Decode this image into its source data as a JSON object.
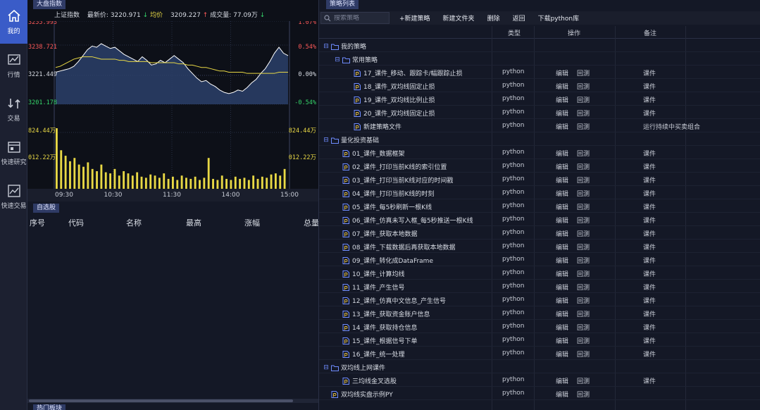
{
  "nav": [
    {
      "label": "我的",
      "icon": "home-icon",
      "active": true
    },
    {
      "label": "行情",
      "icon": "line-chart-icon"
    },
    {
      "label": "交易",
      "icon": "exchange-icon"
    },
    {
      "label": "快速研究",
      "icon": "research-icon"
    },
    {
      "label": "快速交易",
      "icon": "trade-chart-icon"
    }
  ],
  "market": {
    "tab": "大盘指数",
    "name": "上证指数",
    "latest_label": "最新价:",
    "latest": "3220.971",
    "avg_label": "均价",
    "avg": "3209.227",
    "vol_label": "成交量:",
    "vol": "77.09万"
  },
  "chart_data": {
    "type": "line",
    "x_ticks": [
      "09:30",
      "10:30",
      "11:30",
      "14:00",
      "15:00"
    ],
    "y_left_ticks": [
      "3255.993",
      "3238.721",
      "3221.449",
      "3201.178",
      "824.44万",
      "012.22万"
    ],
    "y_right_ticks": [
      "1.07%",
      "0.54%",
      "0.00%",
      "-0.54%",
      "824.44万",
      "012.22万"
    ],
    "ylim": [
      3186.0,
      3256.0
    ],
    "price": [
      3213,
      3214,
      3215,
      3216,
      3218,
      3222,
      3227,
      3232,
      3235,
      3234,
      3237,
      3235,
      3233,
      3234,
      3231,
      3228,
      3226,
      3224,
      3222,
      3226,
      3223,
      3219,
      3220,
      3223,
      3221,
      3224,
      3227,
      3224,
      3221,
      3216,
      3212,
      3208,
      3205,
      3206,
      3203,
      3201,
      3198,
      3196,
      3195,
      3196,
      3198,
      3197,
      3200,
      3204,
      3207,
      3212,
      3216,
      3222,
      3229,
      3234,
      3229,
      3227
    ],
    "avg": [
      3217,
      3218,
      3220,
      3222,
      3224,
      3225,
      3226,
      3226,
      3226,
      3225,
      3224,
      3224,
      3224,
      3224,
      3223,
      3223,
      3222,
      3222,
      3222,
      3222,
      3222,
      3221,
      3221,
      3221,
      3221,
      3221,
      3221,
      3220,
      3220,
      3219,
      3219,
      3218,
      3217,
      3217,
      3216,
      3215,
      3214,
      3214,
      3213,
      3213,
      3213,
      3213,
      3212,
      3212,
      3212,
      3212,
      3212,
      3212,
      3212,
      3213,
      3213,
      3213
    ],
    "volume": [
      55,
      35,
      30,
      25,
      28,
      22,
      20,
      24,
      18,
      16,
      22,
      15,
      14,
      18,
      12,
      16,
      14,
      12,
      15,
      11,
      10,
      13,
      12,
      10,
      14,
      9,
      11,
      8,
      12,
      10,
      9,
      11,
      8,
      10,
      28,
      9,
      8,
      12,
      9,
      8,
      11,
      9,
      10,
      8,
      12,
      9,
      11,
      10,
      13,
      14,
      12,
      18
    ],
    "colors": {
      "price": "#ffffff",
      "avg": "#e8d845",
      "volume": "#e8d845",
      "area": "#2b3f6a"
    }
  },
  "watch": {
    "tab": "自选股",
    "columns": [
      "序号",
      "代码",
      "名称",
      "最高",
      "涨幅",
      "总量"
    ]
  },
  "bottom_tab": "热门板块",
  "strategy": {
    "tab": "策略列表",
    "search_placeholder": "搜索策略",
    "toolbar": [
      "+新建策略",
      "新建文件夹",
      "删除",
      "返回",
      "下载python库"
    ],
    "columns": [
      "类型",
      "操作",
      "备注"
    ],
    "rows": [
      {
        "level": 0,
        "kind": "folder",
        "name": "我的策略",
        "toggle": "⊟"
      },
      {
        "level": 1,
        "kind": "folder",
        "name": "常用策略",
        "toggle": "⊟"
      },
      {
        "level": 2,
        "kind": "file",
        "name": "17_课件_移动、跟踪卡/幅跟踪止损",
        "type": "python",
        "ops": [
          "编辑",
          "回测"
        ],
        "note": "课件"
      },
      {
        "level": 2,
        "kind": "file",
        "name": "18_课件_双均线固定止损",
        "type": "python",
        "ops": [
          "编辑",
          "回测"
        ],
        "note": "课件"
      },
      {
        "level": 2,
        "kind": "file",
        "name": "19_课件_双均线比例止损",
        "type": "python",
        "ops": [
          "编辑",
          "回测"
        ],
        "note": "课件"
      },
      {
        "level": 2,
        "kind": "file",
        "name": "20_课件_双均线固定止损",
        "type": "python",
        "ops": [
          "编辑",
          "回测"
        ],
        "note": "课件"
      },
      {
        "level": 2,
        "kind": "file",
        "name": "新建策略文件",
        "type": "python",
        "ops": [
          "编辑",
          "回测"
        ],
        "note": "运行持续中买卖组合"
      },
      {
        "level": 0,
        "kind": "folder",
        "name": "量化投资基础",
        "toggle": "⊟"
      },
      {
        "level": 1,
        "kind": "file",
        "name": "01_课件_数据框架",
        "type": "python",
        "ops": [
          "编辑",
          "回测"
        ],
        "note": "课件"
      },
      {
        "level": 1,
        "kind": "file",
        "name": "02_课件_打印当前K线的索引位置",
        "type": "python",
        "ops": [
          "编辑",
          "回测"
        ],
        "note": "课件"
      },
      {
        "level": 1,
        "kind": "file",
        "name": "03_课件_打印当前K线对应的时间戳",
        "type": "python",
        "ops": [
          "编辑",
          "回测"
        ],
        "note": "课件"
      },
      {
        "level": 1,
        "kind": "file",
        "name": "04_课件_打印当前K线的时刻",
        "type": "python",
        "ops": [
          "编辑",
          "回测"
        ],
        "note": "课件"
      },
      {
        "level": 1,
        "kind": "file",
        "name": "05_课件_每5秒刷新一根K线",
        "type": "python",
        "ops": [
          "编辑",
          "回测"
        ],
        "note": "课件"
      },
      {
        "level": 1,
        "kind": "file",
        "name": "06_课件_仿真未写入框_每5秒推送一根K线",
        "type": "python",
        "ops": [
          "编辑",
          "回测"
        ],
        "note": "课件"
      },
      {
        "level": 1,
        "kind": "file",
        "name": "07_课件_获取本地数据",
        "type": "python",
        "ops": [
          "编辑",
          "回测"
        ],
        "note": "课件"
      },
      {
        "level": 1,
        "kind": "file",
        "name": "08_课件_下载数据后再获取本地数据",
        "type": "python",
        "ops": [
          "编辑",
          "回测"
        ],
        "note": "课件"
      },
      {
        "level": 1,
        "kind": "file",
        "name": "09_课件_转化成DataFrame",
        "type": "python",
        "ops": [
          "编辑",
          "回测"
        ],
        "note": "课件"
      },
      {
        "level": 1,
        "kind": "file",
        "name": "10_课件_计算均线",
        "type": "python",
        "ops": [
          "编辑",
          "回测"
        ],
        "note": "课件"
      },
      {
        "level": 1,
        "kind": "file",
        "name": "11_课件_产生信号",
        "type": "python",
        "ops": [
          "编辑",
          "回测"
        ],
        "note": "课件"
      },
      {
        "level": 1,
        "kind": "file",
        "name": "12_课件_仿真中文信息_产生信号",
        "type": "python",
        "ops": [
          "编辑",
          "回测"
        ],
        "note": "课件"
      },
      {
        "level": 1,
        "kind": "file",
        "name": "13_课件_获取资金账户信息",
        "type": "python",
        "ops": [
          "编辑",
          "回测"
        ],
        "note": "课件"
      },
      {
        "level": 1,
        "kind": "file",
        "name": "14_课件_获取持仓信息",
        "type": "python",
        "ops": [
          "编辑",
          "回测"
        ],
        "note": "课件"
      },
      {
        "level": 1,
        "kind": "file",
        "name": "15_课件_根据信号下单",
        "type": "python",
        "ops": [
          "编辑",
          "回测"
        ],
        "note": "课件"
      },
      {
        "level": 1,
        "kind": "file",
        "name": "16_课件_统一处理",
        "type": "python",
        "ops": [
          "编辑",
          "回测"
        ],
        "note": "课件"
      },
      {
        "level": 0,
        "kind": "folder",
        "name": "双均线上网课件",
        "toggle": "⊟"
      },
      {
        "level": 1,
        "kind": "file",
        "name": "三均线金叉选股",
        "type": "python",
        "ops": [
          "编辑",
          "回测"
        ],
        "note": "课件"
      },
      {
        "level": 0,
        "kind": "file",
        "name": "双均线实盘示例PY",
        "type": "python",
        "ops": [
          "编辑",
          "回测"
        ],
        "note": ""
      }
    ]
  }
}
